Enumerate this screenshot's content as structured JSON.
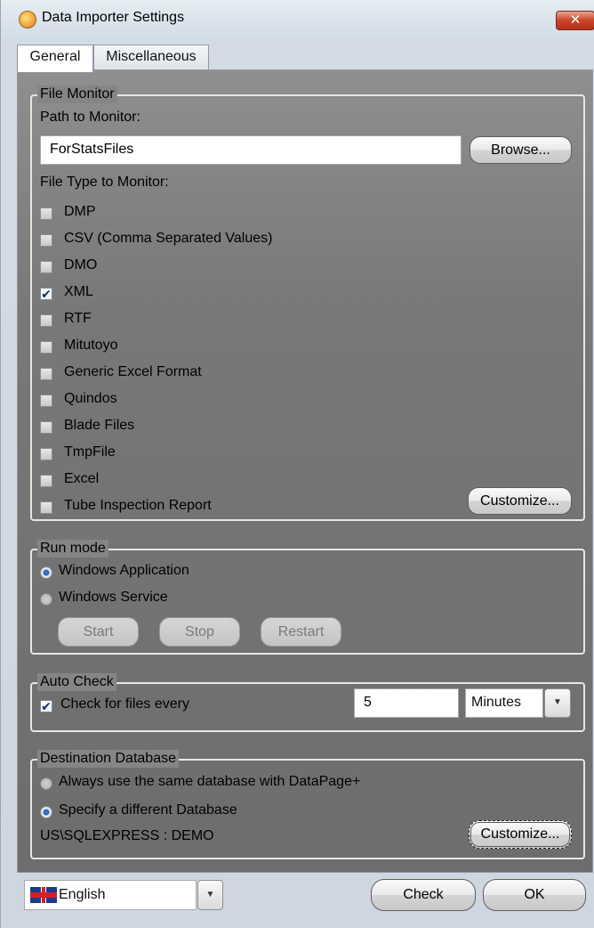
{
  "window": {
    "title": "Data Importer Settings",
    "close_label": "✕"
  },
  "tabs": [
    {
      "label": "General"
    },
    {
      "label": "Miscellaneous"
    }
  ],
  "file_monitor": {
    "legend": "File Monitor",
    "path_label": "Path to Monitor:",
    "path_value": "ForStatsFiles",
    "browse_label": "Browse...",
    "type_label": "File Type to Monitor:",
    "types": [
      {
        "label": "DMP",
        "checked": false
      },
      {
        "label": "CSV (Comma Separated Values)",
        "checked": false
      },
      {
        "label": "DMO",
        "checked": false
      },
      {
        "label": "XML",
        "checked": true
      },
      {
        "label": "RTF",
        "checked": false
      },
      {
        "label": "Mitutoyo",
        "checked": false
      },
      {
        "label": "Generic Excel Format",
        "checked": false
      },
      {
        "label": "Quindos",
        "checked": false
      },
      {
        "label": "Blade Files",
        "checked": false
      },
      {
        "label": "TmpFile",
        "checked": false
      },
      {
        "label": "Excel",
        "checked": false
      },
      {
        "label": "Tube Inspection Report",
        "checked": false
      }
    ],
    "customize_label": "Customize..."
  },
  "run_mode": {
    "legend": "Run mode",
    "options": [
      {
        "label": "Windows Application",
        "selected": true
      },
      {
        "label": "Windows Service",
        "selected": false
      }
    ],
    "start_label": "Start",
    "stop_label": "Stop",
    "restart_label": "Restart"
  },
  "auto_check": {
    "legend": "Auto Check",
    "check_label": "Check for files every",
    "checked": true,
    "interval_value": "5",
    "unit_value": "Minutes"
  },
  "destination": {
    "legend": "Destination Database",
    "options": [
      {
        "label": "Always use the same database with DataPage+",
        "selected": false
      },
      {
        "label": "Specify a different Database",
        "selected": true
      }
    ],
    "db_text": "US\\SQLEXPRESS : DEMO",
    "customize_label": "Customize..."
  },
  "footer": {
    "language_value": "English",
    "check_label": "Check",
    "ok_label": "OK"
  },
  "glyphs": {
    "check": "✔",
    "dropdown": "▼"
  }
}
